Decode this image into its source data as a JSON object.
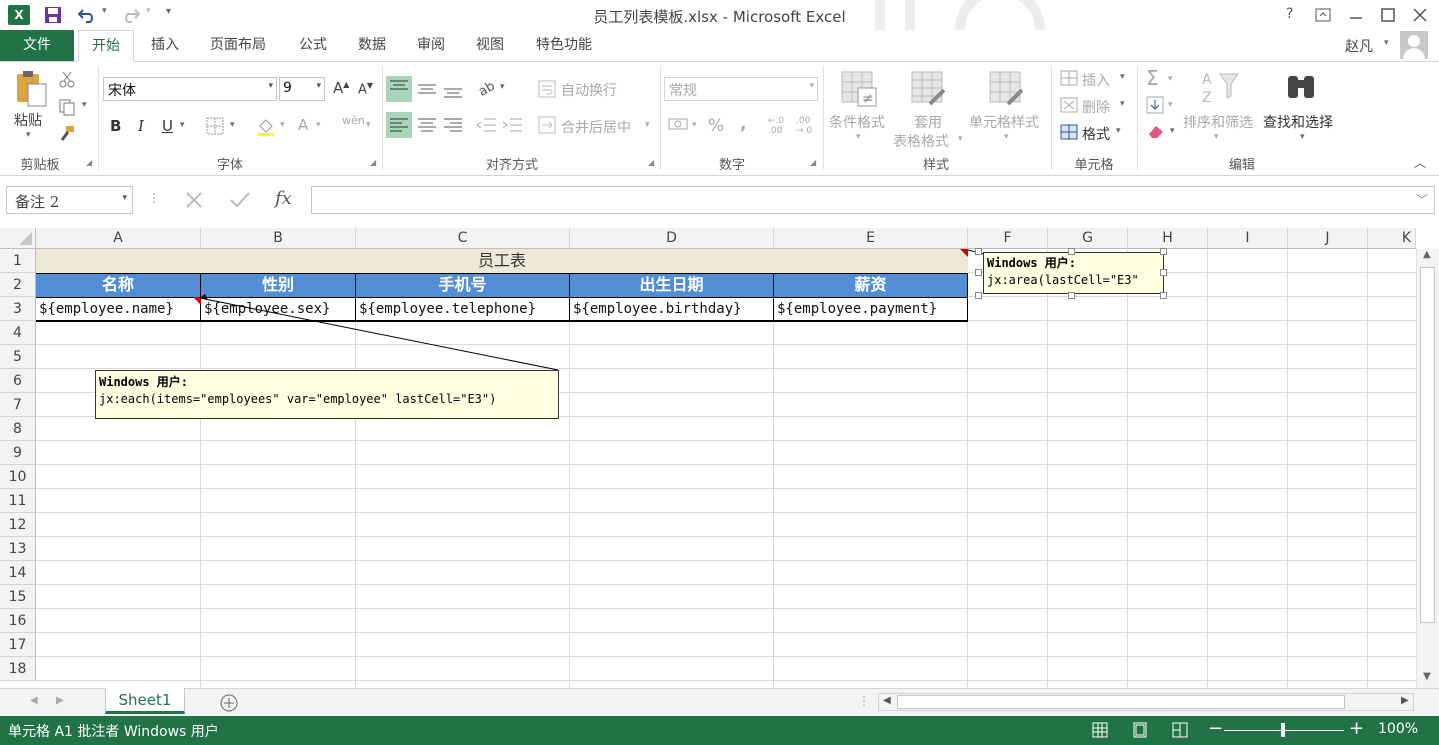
{
  "window": {
    "title": "员工列表模板.xlsx - Microsoft Excel",
    "help": "?",
    "user_name": "赵凡"
  },
  "tabs": [
    {
      "label": "文件"
    },
    {
      "label": "开始"
    },
    {
      "label": "插入"
    },
    {
      "label": "页面布局"
    },
    {
      "label": "公式"
    },
    {
      "label": "数据"
    },
    {
      "label": "审阅"
    },
    {
      "label": "视图"
    },
    {
      "label": "特色功能"
    }
  ],
  "ribbon": {
    "clipboard": {
      "label": "剪贴板",
      "paste": "粘贴"
    },
    "font": {
      "label": "字体",
      "font_name": "宋体",
      "font_size": "9",
      "bold": "B",
      "italic": "I",
      "underline": "U"
    },
    "align": {
      "label": "对齐方式",
      "wrap": "自动换行",
      "merge": "合并后居中"
    },
    "number": {
      "label": "数字",
      "format": "常规"
    },
    "styles": {
      "label": "样式",
      "cond": "条件格式",
      "table1": "套用",
      "table2": "表格格式",
      "cell": "单元格样式"
    },
    "cells": {
      "label": "单元格",
      "insert": "插入",
      "delete": "删除",
      "format": "格式"
    },
    "edit": {
      "label": "编辑",
      "sort": "排序和筛选",
      "find": "查找和选择"
    }
  },
  "formula_bar": {
    "name_box": "备注 2",
    "fx": "fx",
    "value": ""
  },
  "columns": [
    "A",
    "B",
    "C",
    "D",
    "E",
    "F",
    "G",
    "H",
    "I",
    "J",
    "K"
  ],
  "rows": [
    "1",
    "2",
    "3",
    "4",
    "5",
    "6",
    "7",
    "8",
    "9",
    "10",
    "11",
    "12",
    "13",
    "14",
    "15",
    "16",
    "17",
    "18"
  ],
  "sheet": {
    "title_cell": "员工表",
    "headers": [
      "名称",
      "性别",
      "手机号",
      "出生日期",
      "薪资"
    ],
    "templates": [
      "${employee.name}",
      "${employee.sex}",
      "${employee.telephone}",
      "${employee.birthday}",
      "${employee.payment}"
    ]
  },
  "comments": [
    {
      "author": "Windows 用户:",
      "text": "jx:area(lastCell=\"E3\""
    },
    {
      "author": "Windows 用户:",
      "text": "jx:each(items=\"employees\" var=\"employee\" lastCell=\"E3\")"
    }
  ],
  "sheet_tabs": [
    {
      "label": "Sheet1"
    }
  ],
  "status": {
    "text": "单元格 A1 批注者 Windows 用户",
    "zoom": "100%"
  },
  "colors": {
    "excel_green": "#217346",
    "header_blue": "#538dd5",
    "title_fill": "#ece9d8",
    "comment_fill": "#ffffe1"
  }
}
